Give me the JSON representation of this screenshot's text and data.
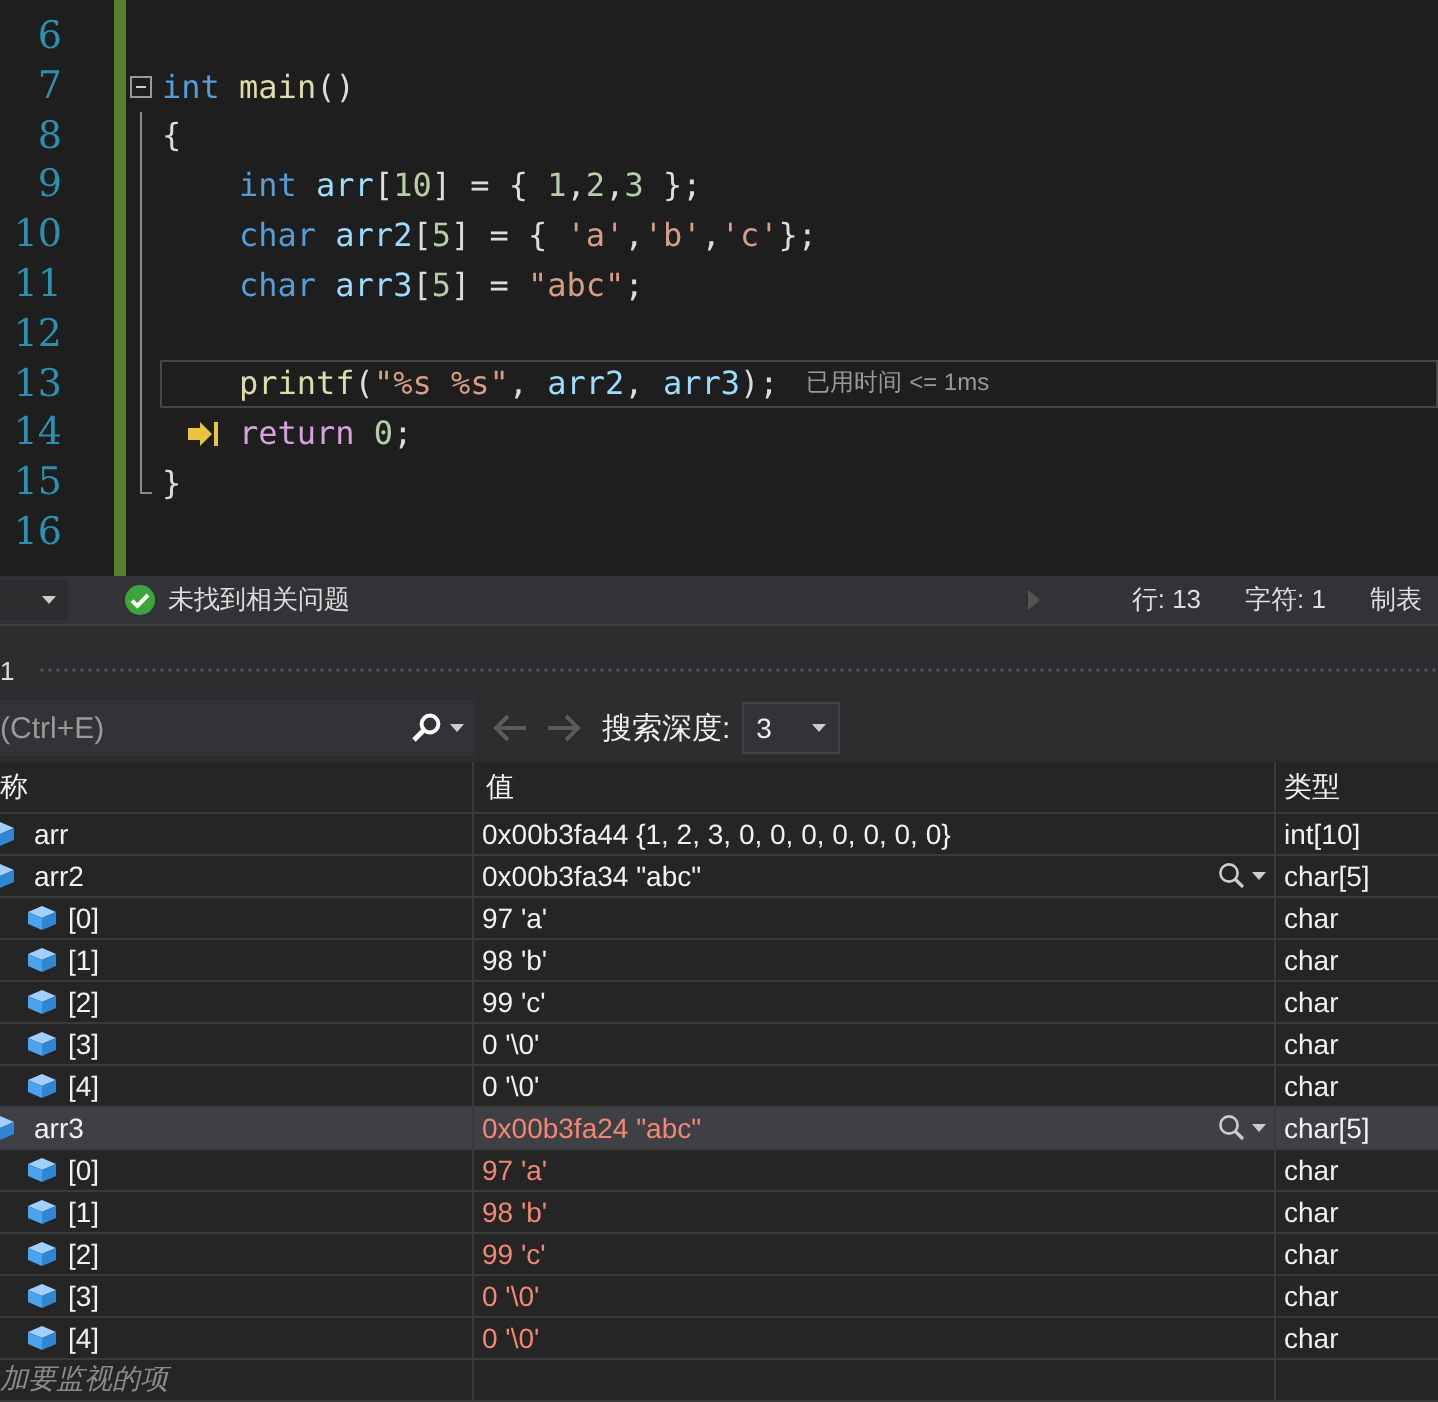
{
  "editor": {
    "lines": [
      {
        "number": "6",
        "in_fold": false,
        "fold_start": false,
        "fold_end": false,
        "current": false,
        "next_statement": false
      },
      {
        "number": "7",
        "in_fold": false,
        "fold_start": true,
        "fold_end": false,
        "indented": false,
        "current": false,
        "next_statement": false,
        "tokens": [
          {
            "kind": "kw",
            "text": "int"
          },
          {
            "kind": "func",
            "text": " main"
          },
          {
            "kind": "plain",
            "text": "()"
          }
        ]
      },
      {
        "number": "8",
        "in_fold": true,
        "fold_start": false,
        "fold_end": false,
        "indented": false,
        "current": false,
        "next_statement": false,
        "tokens": [
          {
            "kind": "plain",
            "text": "{"
          }
        ]
      },
      {
        "number": "9",
        "in_fold": true,
        "fold_start": false,
        "fold_end": false,
        "indented": true,
        "current": false,
        "next_statement": false,
        "tokens": [
          {
            "kind": "kw",
            "text": "int"
          },
          {
            "kind": "ident",
            "text": " arr"
          },
          {
            "kind": "plain",
            "text": "["
          },
          {
            "kind": "num",
            "text": "10"
          },
          {
            "kind": "plain",
            "text": "] = { "
          },
          {
            "kind": "num",
            "text": "1"
          },
          {
            "kind": "plain",
            "text": ","
          },
          {
            "kind": "num",
            "text": "2"
          },
          {
            "kind": "plain",
            "text": ","
          },
          {
            "kind": "num",
            "text": "3"
          },
          {
            "kind": "plain",
            "text": " };"
          }
        ]
      },
      {
        "number": "10",
        "in_fold": true,
        "fold_start": false,
        "fold_end": false,
        "indented": true,
        "current": false,
        "next_statement": false,
        "tokens": [
          {
            "kind": "kw",
            "text": "char"
          },
          {
            "kind": "ident",
            "text": " arr2"
          },
          {
            "kind": "plain",
            "text": "["
          },
          {
            "kind": "num",
            "text": "5"
          },
          {
            "kind": "plain",
            "text": "] = { "
          },
          {
            "kind": "str",
            "text": "'a'"
          },
          {
            "kind": "plain",
            "text": ","
          },
          {
            "kind": "str",
            "text": "'b'"
          },
          {
            "kind": "plain",
            "text": ","
          },
          {
            "kind": "str",
            "text": "'c'"
          },
          {
            "kind": "plain",
            "text": "};"
          }
        ]
      },
      {
        "number": "11",
        "in_fold": true,
        "fold_start": false,
        "fold_end": false,
        "indented": true,
        "current": false,
        "next_statement": false,
        "tokens": [
          {
            "kind": "kw",
            "text": "char"
          },
          {
            "kind": "ident",
            "text": " arr3"
          },
          {
            "kind": "plain",
            "text": "["
          },
          {
            "kind": "num",
            "text": "5"
          },
          {
            "kind": "plain",
            "text": "] = "
          },
          {
            "kind": "str",
            "text": "\"abc\""
          },
          {
            "kind": "plain",
            "text": ";"
          }
        ]
      },
      {
        "number": "12",
        "in_fold": true,
        "fold_start": false,
        "fold_end": false,
        "current": false,
        "next_statement": false
      },
      {
        "number": "13",
        "in_fold": true,
        "fold_start": false,
        "fold_end": false,
        "indented": true,
        "current": true,
        "next_statement": false,
        "hint": "已用时间 <= 1ms",
        "tokens": [
          {
            "kind": "func",
            "text": "printf"
          },
          {
            "kind": "plain",
            "text": "("
          },
          {
            "kind": "str",
            "text": "\"%s %s\""
          },
          {
            "kind": "plain",
            "text": ", "
          },
          {
            "kind": "ident",
            "text": "arr2"
          },
          {
            "kind": "plain",
            "text": ", "
          },
          {
            "kind": "ident",
            "text": "arr3"
          },
          {
            "kind": "plain",
            "text": ");"
          }
        ]
      },
      {
        "number": "14",
        "in_fold": true,
        "fold_start": false,
        "fold_end": false,
        "indented": true,
        "current": false,
        "next_statement": true,
        "tokens": [
          {
            "kind": "ctrl",
            "text": "return"
          },
          {
            "kind": "num",
            "text": " 0"
          },
          {
            "kind": "plain",
            "text": ";"
          }
        ]
      },
      {
        "number": "15",
        "in_fold": false,
        "fold_start": false,
        "fold_end": true,
        "indented": false,
        "current": false,
        "next_statement": false,
        "tokens": [
          {
            "kind": "plain",
            "text": "}"
          }
        ]
      },
      {
        "number": "16",
        "in_fold": false,
        "fold_start": false,
        "fold_end": false,
        "current": false,
        "next_statement": false
      }
    ]
  },
  "status_bar": {
    "issues": "未找到相关问题",
    "line": "行: 13",
    "char": "字符: 1",
    "tabs": "制表"
  },
  "watch": {
    "title": "1",
    "search": {
      "placeholder": "(Ctrl+E)"
    },
    "depth_label": "搜索深度:",
    "depth": "3",
    "columns": [
      "称",
      "值",
      "类型"
    ],
    "rows": [
      {
        "name": "arr",
        "value": "0x00b3fa44 {1, 2, 3, 0, 0, 0, 0, 0, 0, 0}",
        "type": "int[10]",
        "changed": false,
        "selected": false,
        "visualizer": false
      },
      {
        "name": "arr2",
        "value": "0x00b3fa34 \"abc\"",
        "type": "char[5]",
        "changed": false,
        "selected": false,
        "visualizer": true,
        "children": [
          {
            "name": "[0]",
            "value": "97 'a'",
            "type": "char",
            "changed": false
          },
          {
            "name": "[1]",
            "value": "98 'b'",
            "type": "char",
            "changed": false
          },
          {
            "name": "[2]",
            "value": "99 'c'",
            "type": "char",
            "changed": false
          },
          {
            "name": "[3]",
            "value": "0 '\\0'",
            "type": "char",
            "changed": false
          },
          {
            "name": "[4]",
            "value": "0 '\\0'",
            "type": "char",
            "changed": false
          }
        ]
      },
      {
        "name": "arr3",
        "value": "0x00b3fa24 \"abc\"",
        "type": "char[5]",
        "changed": true,
        "selected": true,
        "visualizer": true,
        "children": [
          {
            "name": "[0]",
            "value": "97 'a'",
            "type": "char",
            "changed": true
          },
          {
            "name": "[1]",
            "value": "98 'b'",
            "type": "char",
            "changed": true
          },
          {
            "name": "[2]",
            "value": "99 'c'",
            "type": "char",
            "changed": true
          },
          {
            "name": "[3]",
            "value": "0 '\\0'",
            "type": "char",
            "changed": true
          },
          {
            "name": "[4]",
            "value": "0 '\\0'",
            "type": "char",
            "changed": true
          }
        ]
      }
    ],
    "add_placeholder": "加要监视的项"
  }
}
